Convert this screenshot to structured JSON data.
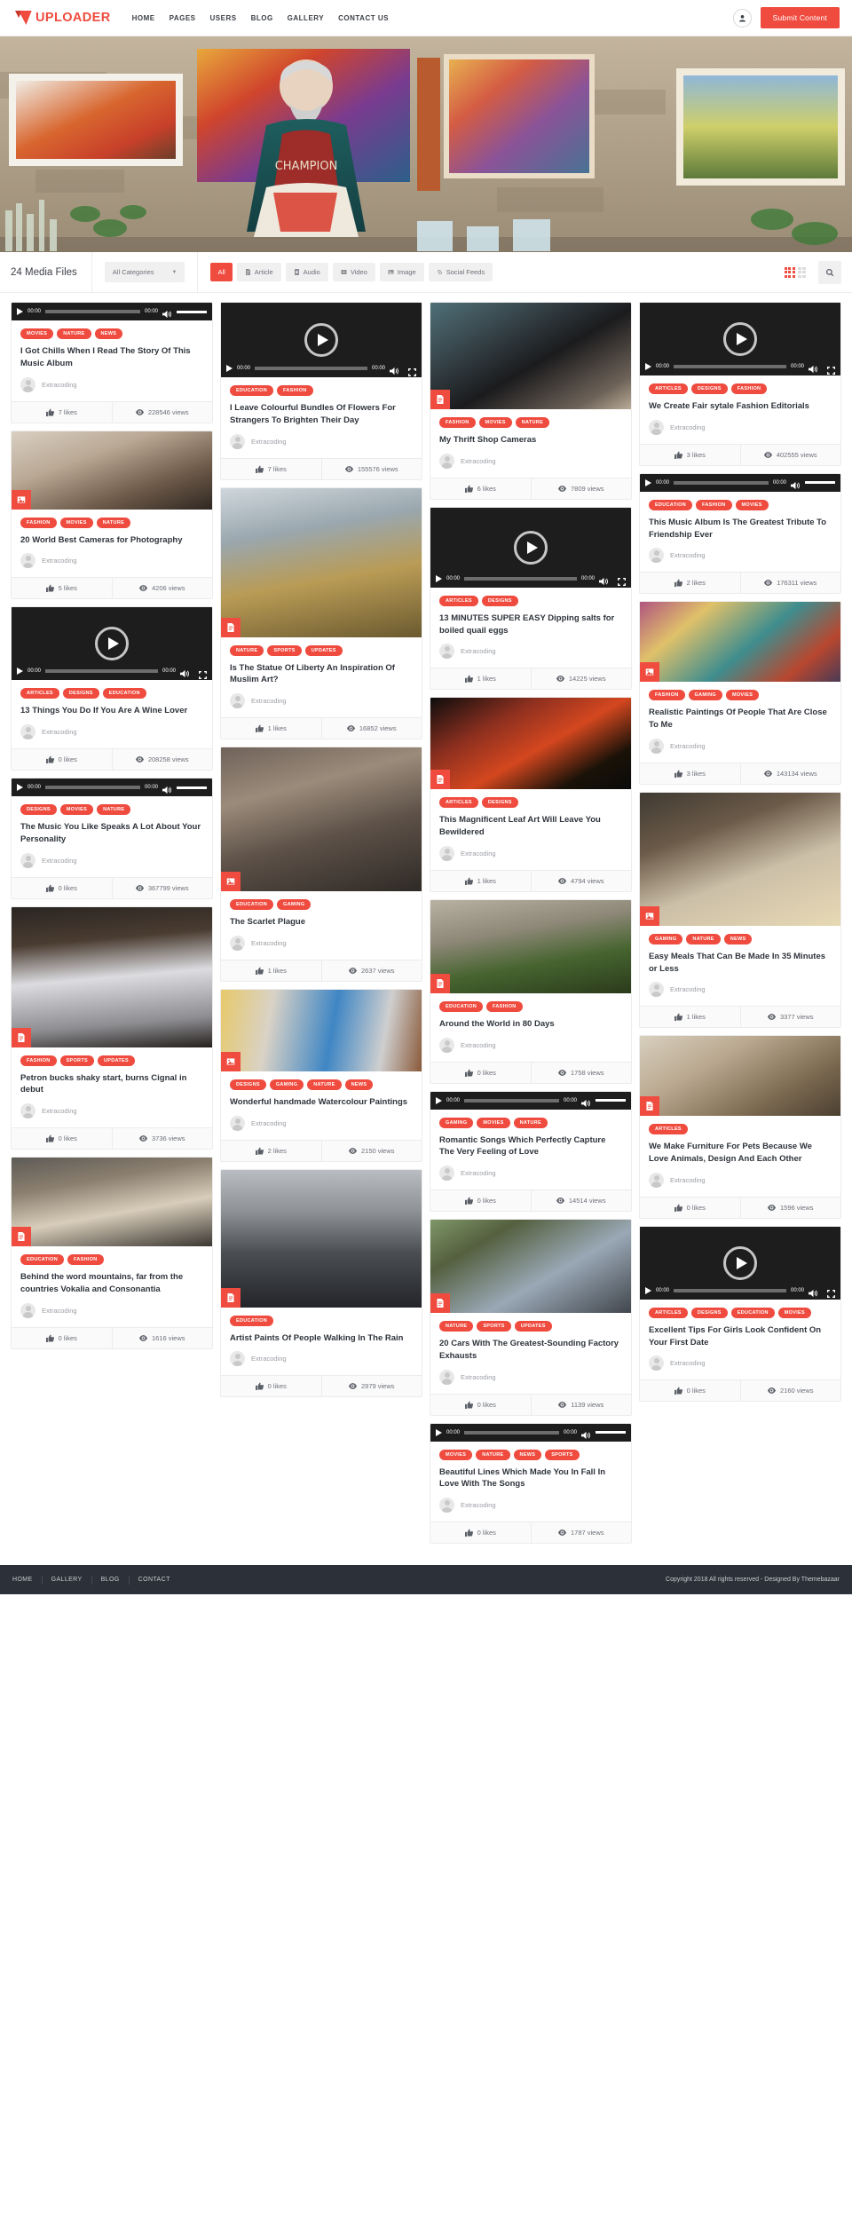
{
  "header": {
    "logo_text": "UPLOADER",
    "logo_icon": "uploader-logo-icon",
    "nav": [
      {
        "label": "HOME"
      },
      {
        "label": "PAGES"
      },
      {
        "label": "USERS"
      },
      {
        "label": "BLOG"
      },
      {
        "label": "GALLERY"
      },
      {
        "label": "CONTACT US"
      }
    ],
    "user_icon": "user-icon",
    "submit_label": "Submit Content"
  },
  "filterbar": {
    "media_count": "24 Media Files",
    "category_select": "All Categories",
    "caret_icon": "chevron-down-icon",
    "chips": [
      {
        "label": "All",
        "icon": "",
        "active": true
      },
      {
        "label": "Article",
        "icon": "article-icon",
        "active": false
      },
      {
        "label": "Audio",
        "icon": "audio-icon",
        "active": false
      },
      {
        "label": "Video",
        "icon": "video-icon",
        "active": false
      },
      {
        "label": "Image",
        "icon": "image-icon",
        "active": false
      },
      {
        "label": "Social Feeds",
        "icon": "link-icon",
        "active": false
      }
    ],
    "grid_view_icon": "grid-view-icon",
    "list_view_icon": "list-view-icon",
    "search_icon": "search-icon"
  },
  "player": {
    "time_start": "00:00",
    "time_end": "00:00",
    "play_icon": "play-icon",
    "volume_icon": "volume-icon",
    "fullscreen_icon": "fullscreen-icon"
  },
  "stats_labels": {
    "likes_icon": "thumbs-up-icon",
    "views_icon": "eye-icon"
  },
  "author_default": "Extracoding",
  "colors": {
    "accent": "#ef4b3f",
    "footer_bg": "#2b3039",
    "text": "#2f343c",
    "muted": "#9b9ea4"
  },
  "columns": [
    [
      {
        "type": "audio",
        "media_kind": "audio-player",
        "tags": [
          "MOVIES",
          "NATURE",
          "NEWS"
        ],
        "title": "I Got Chills When I Read The Story Of This Music Album",
        "author": "Extracoding",
        "likes": "7 likes",
        "views": "228546 views",
        "thumb_h": 0,
        "thumb_css": ""
      },
      {
        "type": "image",
        "media_kind": "image",
        "badge_icon": "image-icon",
        "tags": [
          "FASHION",
          "MOVIES",
          "NATURE"
        ],
        "title": "20 World Best Cameras for Photography",
        "author": "Extracoding",
        "likes": "5 likes",
        "views": "4206 views",
        "thumb_h": 88,
        "thumb_css": "linear-gradient(160deg,#d9cfc2 0%,#b9a894 35%,#6d5a49 70%,#2f2722 100%)"
      },
      {
        "type": "video",
        "media_kind": "video-player",
        "tags": [
          "ARTICLES",
          "DESIGNS",
          "EDUCATION"
        ],
        "title": "13 Things You Do If You Are A Wine Lover",
        "author": "Extracoding",
        "likes": "0 likes",
        "views": "208258 views",
        "thumb_h": 62,
        "thumb_css": "#1d1d1d"
      },
      {
        "type": "audio",
        "media_kind": "audio-player",
        "tags": [
          "DESIGNS",
          "MOVIES",
          "NATURE"
        ],
        "title": "The Music You Like Speaks A Lot About Your Personality",
        "author": "Extracoding",
        "likes": "0 likes",
        "views": "367799 views",
        "thumb_h": 0,
        "thumb_css": ""
      },
      {
        "type": "article",
        "media_kind": "image",
        "badge_icon": "article-icon",
        "tags": [
          "FASHION",
          "SPORTS",
          "UPDATES"
        ],
        "title": "Petron bucks shaky start, burns Cignal in debut",
        "author": "Extracoding",
        "likes": "0 likes",
        "views": "3736 views",
        "thumb_h": 158,
        "thumb_css": "linear-gradient(175deg,#2a2522 0%,#4a3c31 25%,#dcdce0 50%,#8e8e92 80%,#25201d 100%)"
      },
      {
        "type": "article",
        "media_kind": "image",
        "badge_icon": "article-icon",
        "tags": [
          "EDUCATION",
          "FASHION"
        ],
        "title": "Behind the word mountains, far from the countries Vokalia and Consonantia",
        "author": "Extracoding",
        "likes": "0 likes",
        "views": "1616 views",
        "thumb_h": 100,
        "thumb_css": "linear-gradient(170deg,#5d5a56 0%,#8b7f6f 30%,#d8cdba 60%,#3b3732 100%)"
      }
    ],
    [
      {
        "type": "video",
        "media_kind": "video-player",
        "tags": [
          "EDUCATION",
          "FASHION"
        ],
        "title": "I Leave Colourful Bundles Of Flowers For Strangers To Brighten Their Day",
        "author": "Extracoding",
        "likes": "7 likes",
        "views": "155576 views",
        "thumb_h": 64,
        "thumb_css": "#1d1d1d"
      },
      {
        "type": "article",
        "media_kind": "image",
        "badge_icon": "article-icon",
        "tags": [
          "NATURE",
          "SPORTS",
          "UPDATES"
        ],
        "title": "Is The Statue Of Liberty An Inspiration Of Muslim Art?",
        "author": "Extracoding",
        "likes": "1 likes",
        "views": "16852 views",
        "thumb_h": 168,
        "thumb_css": "linear-gradient(170deg,#cfd7dc 0%,#9aa7ae 30%,#b99b55 60%,#6b5a30 100%)"
      },
      {
        "type": "image",
        "media_kind": "image",
        "badge_icon": "image-icon",
        "tags": [
          "EDUCATION",
          "GAMING"
        ],
        "title": "The Scarlet Plague",
        "author": "Extracoding",
        "likes": "1 likes",
        "views": "2637 views",
        "thumb_h": 162,
        "thumb_css": "linear-gradient(165deg,#6f625a 0%,#9b8b7a 30%,#5d5148 60%,#2f2a26 100%)"
      },
      {
        "type": "image",
        "media_kind": "image",
        "badge_icon": "image-icon",
        "tags": [
          "DESIGNS",
          "GAMING",
          "NATURE",
          "NEWS"
        ],
        "title": "Wonderful handmade Watercolour Paintings",
        "author": "Extracoding",
        "likes": "2 likes",
        "views": "2150 views",
        "thumb_h": 92,
        "thumb_css": "linear-gradient(100deg,#e7c96a 0%,#d9d2c6 25%,#3f86c4 55%,#cfcfcf 80%,#8a5a3a 100%)"
      },
      {
        "type": "article",
        "media_kind": "image",
        "badge_icon": "article-icon",
        "tags": [
          "EDUCATION"
        ],
        "title": "Artist Paints Of People Walking In The Rain",
        "author": "Extracoding",
        "likes": "0 likes",
        "views": "2979 views",
        "thumb_h": 155,
        "thumb_css": "linear-gradient(180deg,#b9bcc0 0%,#8e9296 30%,#4b4e52 60%,#23252a 100%)"
      }
    ],
    [
      {
        "type": "article",
        "media_kind": "image",
        "badge_icon": "article-icon",
        "tags": [
          "FASHION",
          "MOVIES",
          "NATURE"
        ],
        "title": "My Thrift Shop Cameras",
        "author": "Extracoding",
        "likes": "6 likes",
        "views": "7809 views",
        "thumb_h": 120,
        "thumb_css": "linear-gradient(150deg,#4f6f77 0%,#3a4a50 25%,#1b1b1d 55%,#6d6258 85%,#b9ab97 100%)"
      },
      {
        "type": "video",
        "media_kind": "video-player",
        "tags": [
          "ARTICLES",
          "DESIGNS"
        ],
        "title": "13 MINUTES SUPER EASY Dipping salts for boiled quail eggs",
        "author": "Extracoding",
        "likes": "1 likes",
        "views": "14225 views",
        "thumb_h": 70,
        "thumb_css": "#1d1d1d"
      },
      {
        "type": "article",
        "media_kind": "image",
        "badge_icon": "article-icon",
        "tags": [
          "ARTICLES",
          "DESIGNS"
        ],
        "title": "This Magnificent Leaf Art Will Leave You Bewildered",
        "author": "Extracoding",
        "likes": "1 likes",
        "views": "4794 views",
        "thumb_h": 103,
        "thumb_css": "linear-gradient(150deg,#0d0d0d 0%,#8c2f1f 30%,#d4471f 55%,#1a1208 80%,#0a0a0a 100%)"
      },
      {
        "type": "article",
        "media_kind": "image",
        "badge_icon": "article-icon",
        "tags": [
          "EDUCATION",
          "FASHION"
        ],
        "title": "Around the World in 80 Days",
        "author": "Extracoding",
        "likes": "0 likes",
        "views": "1758 views",
        "thumb_h": 105,
        "thumb_css": "linear-gradient(170deg,#b9b2a4 0%,#8e8878 35%,#46642f 65%,#2b3a1c 100%)"
      },
      {
        "type": "audio",
        "media_kind": "audio-player",
        "tags": [
          "GAMING",
          "MOVIES",
          "NATURE"
        ],
        "title": "Romantic Songs Which Perfectly Capture The Very Feeling of Love",
        "author": "Extracoding",
        "likes": "0 likes",
        "views": "14514 views",
        "thumb_h": 0,
        "thumb_css": ""
      },
      {
        "type": "article",
        "media_kind": "image",
        "badge_icon": "article-icon",
        "tags": [
          "NATURE",
          "SPORTS",
          "UPDATES"
        ],
        "title": "20 Cars With The Greatest-Sounding Factory Exhausts",
        "author": "Extracoding",
        "likes": "0 likes",
        "views": "1139 views",
        "thumb_h": 105,
        "thumb_css": "linear-gradient(150deg,#7f9768 0%,#54603f 25%,#9aa8b6 60%,#41464c 100%)"
      },
      {
        "type": "audio",
        "media_kind": "audio-player",
        "tags": [
          "MOVIES",
          "NATURE",
          "NEWS",
          "SPORTS"
        ],
        "title": "Beautiful Lines Which Made You In Fall In Love With The Songs",
        "author": "Extracoding",
        "likes": "0 likes",
        "views": "1787 views",
        "thumb_h": 0,
        "thumb_css": ""
      }
    ],
    [
      {
        "type": "video",
        "media_kind": "video-player",
        "tags": [
          "ARTICLES",
          "DESIGNS",
          "FASHION"
        ],
        "title": "We Create Fair sytale Fashion Editorials",
        "author": "Extracoding",
        "likes": "3 likes",
        "views": "402555 views",
        "thumb_h": 62,
        "thumb_css": "#1d1d1d"
      },
      {
        "type": "audio",
        "media_kind": "audio-player",
        "tags": [
          "EDUCATION",
          "FASHION",
          "MOVIES"
        ],
        "title": "This Music Album Is The Greatest Tribute To Friendship Ever",
        "author": "Extracoding",
        "likes": "2 likes",
        "views": "176311 views",
        "thumb_h": 0,
        "thumb_css": ""
      },
      {
        "type": "image",
        "media_kind": "image",
        "badge_icon": "image-icon",
        "tags": [
          "FASHION",
          "GAMING",
          "MOVIES"
        ],
        "title": "Realistic Paintings Of People That Are Close To Me",
        "author": "Extracoding",
        "likes": "3 likes",
        "views": "143134 views",
        "thumb_h": 90,
        "thumb_css": "linear-gradient(140deg,#b0557f 0%,#e0c16a 25%,#3f8d8e 55%,#b8472f 80%,#4a3a55 100%)"
      },
      {
        "type": "image",
        "media_kind": "image",
        "badge_icon": "image-icon",
        "tags": [
          "GAMING",
          "NATURE",
          "NEWS"
        ],
        "title": "Easy Meals That Can Be Made In 35 Minutes or Less",
        "author": "Extracoding",
        "likes": "1 likes",
        "views": "3377 views",
        "thumb_h": 150,
        "thumb_css": "linear-gradient(160deg,#3f3a33 0%,#6b5a48 30%,#cbbfa8 60%,#e8d9b4 100%)"
      },
      {
        "type": "article",
        "media_kind": "image",
        "badge_icon": "article-icon",
        "tags": [
          "ARTICLES"
        ],
        "title": "We Make Furniture For Pets Because We Love Animals, Design And Each Other",
        "author": "Extracoding",
        "likes": "0 likes",
        "views": "1596 views",
        "thumb_h": 90,
        "thumb_css": "linear-gradient(150deg,#d8cfbe 0%,#b9a88f 35%,#7d6b52 70%,#4b3f30 100%)"
      },
      {
        "type": "video",
        "media_kind": "video-player",
        "tags": [
          "ARTICLES",
          "DESIGNS",
          "EDUCATION",
          "MOVIES"
        ],
        "title": "Excellent Tips For Girls Look Confident On Your First Date",
        "author": "Extracoding",
        "likes": "0 likes",
        "views": "2160 views",
        "thumb_h": 62,
        "thumb_css": "#1d1d1d"
      }
    ]
  ],
  "footer": {
    "nav": [
      {
        "label": "HOME"
      },
      {
        "label": "GALLERY"
      },
      {
        "label": "BLOG"
      },
      {
        "label": "CONTACT"
      }
    ],
    "copyright": "Copyright 2018 All rights reserved - Designed By Themebazaar"
  }
}
